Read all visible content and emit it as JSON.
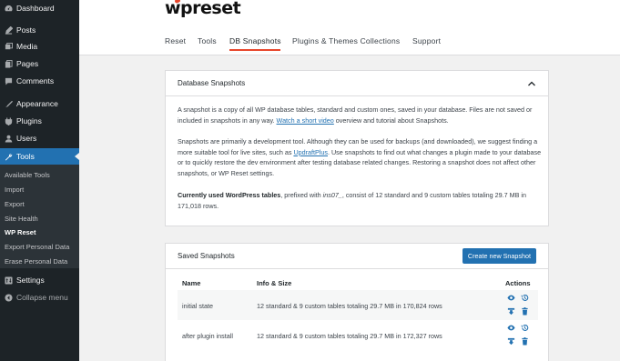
{
  "sidebar": {
    "items": [
      {
        "label": "Dashboard",
        "icon": "dashboard-icon"
      },
      {
        "label": "Posts",
        "icon": "posts-icon"
      },
      {
        "label": "Media",
        "icon": "media-icon"
      },
      {
        "label": "Pages",
        "icon": "pages-icon"
      },
      {
        "label": "Comments",
        "icon": "comments-icon"
      },
      {
        "label": "Appearance",
        "icon": "appearance-icon"
      },
      {
        "label": "Plugins",
        "icon": "plugins-icon"
      },
      {
        "label": "Users",
        "icon": "users-icon"
      },
      {
        "label": "Tools",
        "icon": "tools-icon"
      },
      {
        "label": "Settings",
        "icon": "settings-icon"
      },
      {
        "label": "Collapse menu",
        "icon": "collapse-icon"
      }
    ],
    "submenu": [
      "Available Tools",
      "Import",
      "Export",
      "Site Health",
      "WP Reset",
      "Export Personal Data",
      "Erase Personal Data"
    ]
  },
  "header": {
    "logo": "wpreset",
    "tabs": [
      "Reset",
      "Tools",
      "DB Snapshots",
      "Plugins & Themes Collections",
      "Support"
    ],
    "active_tab": "DB Snapshots"
  },
  "db_card": {
    "title": "Database Snapshots",
    "p1_a": "A snapshot is a copy of all WP database tables, standard and custom ones, saved in your database. Files are not saved or included in snapshots in any way. ",
    "p1_link": "Watch a short video",
    "p1_b": " overview and tutorial about Snapshots.",
    "p2_a": "Snapshots are primarily a development tool. Although they can be used for backups (and downloaded), we suggest finding a more suitable tool for live sites, such as ",
    "p2_link": "UpdraftPlus",
    "p2_b": ". Use snapshots to find out what changes a plugin made to your database or to quickly restore the dev environment after testing database related changes. Restoring a snapshot does not affect other snapshots, or WP Reset settings.",
    "p3_bold": "Currently used WordPress tables",
    "p3_a": ", prefixed with ",
    "p3_prefix": "ins07_",
    "p3_b": ", consist of 12 standard and 9 custom tables totaling 29.7 MB in 171,018 rows."
  },
  "saved_card": {
    "title": "Saved Snapshots",
    "create_button": "Create new Snapshot",
    "columns": [
      "Name",
      "Info & Size",
      "Actions"
    ],
    "rows": [
      {
        "name": "initial state",
        "info": "12 standard & 9 custom tables totaling 29.7 MB in 170,824 rows"
      },
      {
        "name": "after plugin install",
        "info": "12 standard & 9 custom tables totaling 29.7 MB in 172,327 rows"
      }
    ]
  },
  "colors": {
    "accent": "#2271b1",
    "brand": "#e8462b",
    "sidebar": "#1d2327"
  }
}
